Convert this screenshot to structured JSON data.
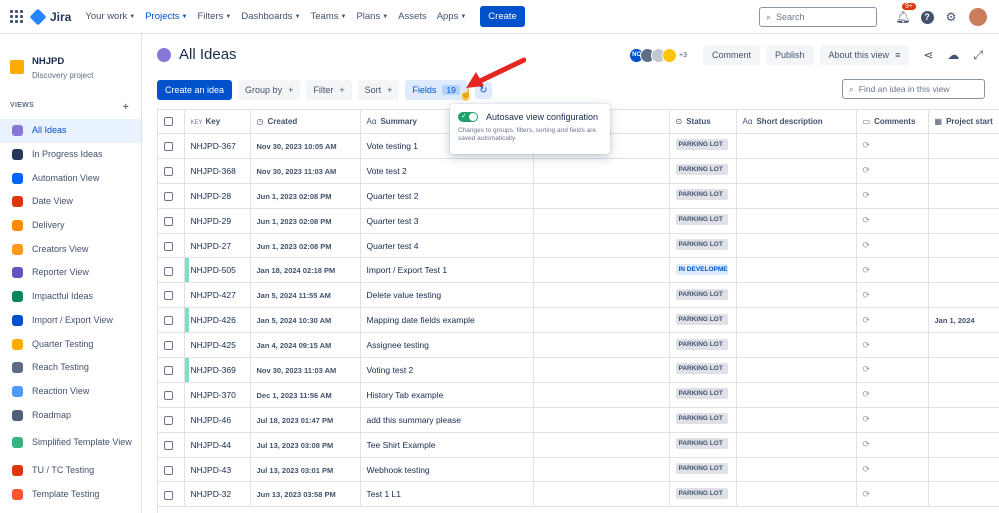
{
  "topnav": {
    "logo_text": "Jira",
    "items": [
      {
        "label": "Your work",
        "active": false
      },
      {
        "label": "Projects",
        "active": true
      },
      {
        "label": "Filters",
        "active": false
      },
      {
        "label": "Dashboards",
        "active": false
      },
      {
        "label": "Teams",
        "active": false
      },
      {
        "label": "Plans",
        "active": false
      },
      {
        "label": "Assets",
        "active": false,
        "nochev": true
      },
      {
        "label": "Apps",
        "active": false
      }
    ],
    "create_label": "Create",
    "search_placeholder": "Search",
    "notifications_badge": "9+"
  },
  "sidebar": {
    "project_name": "NHJPD",
    "project_type": "Discovery project",
    "views_heading": "VIEWS",
    "items": [
      {
        "label": "All Ideas",
        "active": true,
        "icon": "lightbulb-icon",
        "color": "#8777d9"
      },
      {
        "label": "In Progress Ideas",
        "active": false,
        "icon": "columns-icon",
        "color": "#253858"
      },
      {
        "label": "Automation View",
        "active": false,
        "icon": "automation-icon",
        "color": "#0065ff"
      },
      {
        "label": "Date View",
        "active": false,
        "icon": "calendar-icon",
        "color": "#de350b"
      },
      {
        "label": "Delivery",
        "active": false,
        "icon": "truck-icon",
        "color": "#ff8b00"
      },
      {
        "label": "Creators View",
        "active": false,
        "icon": "person-icon",
        "color": "#ff991f"
      },
      {
        "label": "Reporter View",
        "active": false,
        "icon": "megaphone-icon",
        "color": "#6554c0"
      },
      {
        "label": "Impactful Ideas",
        "active": false,
        "icon": "chart-icon",
        "color": "#00875a"
      },
      {
        "label": "Import / Export View",
        "active": false,
        "icon": "import-export-icon",
        "color": "#0052cc"
      },
      {
        "label": "Quarter Testing",
        "active": false,
        "icon": "star-icon",
        "color": "#ffab00"
      },
      {
        "label": "Reach Testing",
        "active": false,
        "icon": "reach-icon",
        "color": "#5e6c84"
      },
      {
        "label": "Reaction View",
        "active": false,
        "icon": "reaction-icon",
        "color": "#4c9aff"
      },
      {
        "label": "Roadmap",
        "active": false,
        "icon": "roadmap-icon",
        "color": "#505f79"
      },
      {
        "label": "Simplified Template View",
        "active": false,
        "icon": "globe-icon",
        "color": "#36b37e",
        "two_line": true
      },
      {
        "label": "TU / TC Testing",
        "active": false,
        "icon": "target-icon",
        "color": "#de350b"
      },
      {
        "label": "Template Testing",
        "active": false,
        "icon": "cone-icon",
        "color": "#ff5630"
      }
    ]
  },
  "header": {
    "title": "All Ideas",
    "avatars": [
      {
        "initials": "NC",
        "color": "#0052cc"
      },
      {
        "initials": "",
        "color": "#5e6c84"
      },
      {
        "initials": "",
        "color": "#c1c7d0"
      },
      {
        "initials": "",
        "color": "#ffc400"
      }
    ],
    "avatars_more": "+3",
    "comment_label": "Comment",
    "publish_label": "Publish",
    "about_label": "About this view"
  },
  "toolbar": {
    "create_idea_label": "Create an idea",
    "group_by_label": "Group by",
    "filter_label": "Filter",
    "sort_label": "Sort",
    "fields_label": "Fields",
    "fields_count": "19",
    "find_placeholder": "Find an idea in this view"
  },
  "table": {
    "columns": {
      "key_prefix": "KEY",
      "key": "Key",
      "created": "Created",
      "summary": "Summary",
      "status": "Status",
      "short_description": "Short description",
      "comments": "Comments",
      "project_start": "Project start"
    },
    "rows": [
      {
        "key": "NHJPD-367",
        "created": "Nov 30, 2023 10:05 AM",
        "summary": "Vote testing 1",
        "status": "PARKING LOT",
        "project_start": "",
        "mark": false
      },
      {
        "key": "NHJPD-368",
        "created": "Nov 30, 2023 11:03 AM",
        "summary": "Vote test 2",
        "status": "PARKING LOT",
        "project_start": "",
        "mark": false
      },
      {
        "key": "NHJPD-28",
        "created": "Jun 1, 2023 02:08 PM",
        "summary": "Quarter test 2",
        "status": "PARKING LOT",
        "project_start": "",
        "mark": false
      },
      {
        "key": "NHJPD-29",
        "created": "Jun 1, 2023 02:08 PM",
        "summary": "Quarter test 3",
        "status": "PARKING LOT",
        "project_start": "",
        "mark": false
      },
      {
        "key": "NHJPD-27",
        "created": "Jun 1, 2023 02:08 PM",
        "summary": "Quarter test 4",
        "status": "PARKING LOT",
        "project_start": "",
        "mark": false
      },
      {
        "key": "NHJPD-505",
        "created": "Jan 18, 2024 02:18 PM",
        "summary": "Import / Export Test 1",
        "status": "IN DEVELOPMENT",
        "project_start": "",
        "mark": true,
        "dev": true
      },
      {
        "key": "NHJPD-427",
        "created": "Jan 5, 2024 11:55 AM",
        "summary": "Delete value testing",
        "status": "PARKING LOT",
        "project_start": "",
        "mark": false
      },
      {
        "key": "NHJPD-426",
        "created": "Jan 5, 2024 10:30 AM",
        "summary": "Mapping date fields example",
        "status": "PARKING LOT",
        "project_start": "Jan 1, 2024",
        "mark": true
      },
      {
        "key": "NHJPD-425",
        "created": "Jan 4, 2024 09:15 AM",
        "summary": "Assignee testing",
        "status": "PARKING LOT",
        "project_start": "",
        "mark": false
      },
      {
        "key": "NHJPD-369",
        "created": "Nov 30, 2023 11:03 AM",
        "summary": "Voting test 2",
        "status": "PARKING LOT",
        "project_start": "",
        "mark": true
      },
      {
        "key": "NHJPD-370",
        "created": "Dec 1, 2023 11:56 AM",
        "summary": "History Tab example",
        "status": "PARKING LOT",
        "project_start": "",
        "mark": false
      },
      {
        "key": "NHJPD-46",
        "created": "Jul 18, 2023 01:47 PM",
        "summary": "add this summary please",
        "status": "PARKING LOT",
        "project_start": "",
        "mark": false
      },
      {
        "key": "NHJPD-44",
        "created": "Jul 13, 2023 03:08 PM",
        "summary": "Tee Shirt Example",
        "status": "PARKING LOT",
        "project_start": "",
        "mark": false
      },
      {
        "key": "NHJPD-43",
        "created": "Jul 13, 2023 03:01 PM",
        "summary": "Webhook testing",
        "status": "PARKING LOT",
        "project_start": "",
        "mark": false
      },
      {
        "key": "NHJPD-32",
        "created": "Jun 13, 2023 03:58 PM",
        "summary": "Test 1 L1",
        "status": "PARKING LOT",
        "project_start": "",
        "mark": false
      }
    ]
  },
  "popover": {
    "title": "Autosave view configuration",
    "description": "Changes to groups, filters, sorting and fields are saved automatically."
  },
  "colors": {
    "brand": "#0052cc",
    "toggle_on": "#22a06b",
    "annotation_arrow": "#e5251f",
    "row_mark": "#79e2c4"
  }
}
